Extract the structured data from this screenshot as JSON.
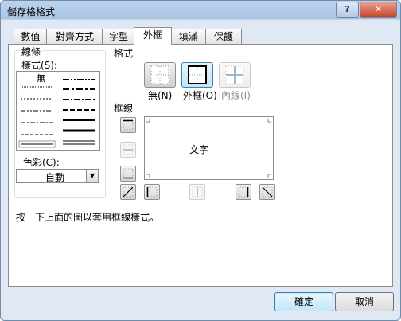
{
  "dialog": {
    "title": "儲存格格式",
    "help_label": "?",
    "close_label": "✕"
  },
  "tabs": [
    {
      "label": "數值"
    },
    {
      "label": "對齊方式"
    },
    {
      "label": "字型"
    },
    {
      "label": "外框"
    },
    {
      "label": "填滿"
    },
    {
      "label": "保護"
    }
  ],
  "active_tab": "外框",
  "line_section": {
    "title": "線條",
    "style_label": "樣式(S):",
    "none_label": "無",
    "color_label": "色彩(C):",
    "color_value": "自動"
  },
  "presets": {
    "title": "格式",
    "none_label": "無(N)",
    "outline_label": "外框(O)",
    "inside_label": "內線(I)"
  },
  "border": {
    "title": "框線",
    "preview_text": "文字"
  },
  "hint": "按一下上面的圖以套用框線樣式。",
  "buttons": {
    "ok": "確定",
    "cancel": "取消"
  },
  "colors": {
    "title_bar": "#a9c4e3",
    "close_button": "#c7452a",
    "accent": "#3c7fb1"
  }
}
